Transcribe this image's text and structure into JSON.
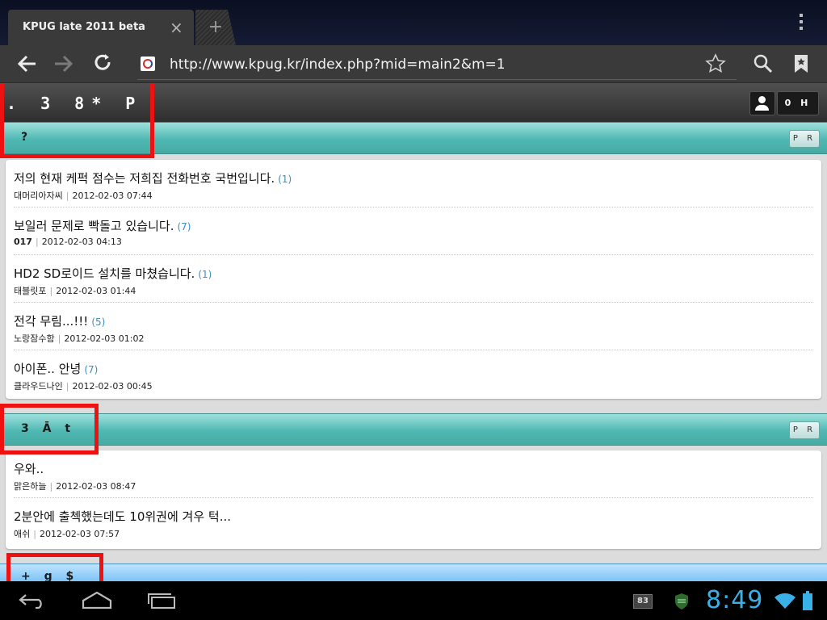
{
  "browser": {
    "tab_title": "KPUG late 2011 beta",
    "tab_close": "×",
    "new_tab": "+",
    "url": "http://www.kpug.kr/index.php?mid=main2&m=1"
  },
  "site": {
    "logo": ". 3 8* P",
    "login_label": "0 H"
  },
  "sections": [
    {
      "title": "?",
      "more_label": "P R",
      "posts": [
        {
          "title": "저의 현재 케퍽 점수는 저희집 전화번호 국번입니다.",
          "count": "(1)",
          "author": "대머리아자씨",
          "date": "2012-02-03 07:44"
        },
        {
          "title": "보일러 문제로 빡돌고 있습니다.",
          "count": "(7)",
          "author": "017",
          "date": "2012-02-03 04:13"
        },
        {
          "title": "HD2 SD로이드 설치를 마쳤습니다.",
          "count": "(1)",
          "author": "태블릿포",
          "date": "2012-02-03 01:44"
        },
        {
          "title": "전각 무림...!!!",
          "count": "(5)",
          "author": "노랑잠수함",
          "date": "2012-02-03 01:02"
        },
        {
          "title": "아이폰.. 안녕",
          "count": "(7)",
          "author": "클라우드나인",
          "date": "2012-02-03 00:45"
        }
      ]
    },
    {
      "title": "3 Ā t",
      "more_label": "P R",
      "posts": [
        {
          "title": "우와..",
          "count": "",
          "author": "맑은하늘",
          "date": "2012-02-03 08:47"
        },
        {
          "title": "2분안에 출첵했는데도 10위권에 겨우 턱...",
          "count": "",
          "author": "애쉬",
          "date": "2012-02-03 07:57"
        }
      ]
    },
    {
      "title": "+ g $",
      "more_label": ""
    }
  ],
  "system": {
    "notif_count": "83",
    "clock": "8:49"
  },
  "colors": {
    "section_teal": "#4fb8b2",
    "section_blue": "#7cc3f5",
    "highlight_red": "#ee1111",
    "clock_blue": "#3ab0e8",
    "comment_count": "#3a8fc0"
  }
}
